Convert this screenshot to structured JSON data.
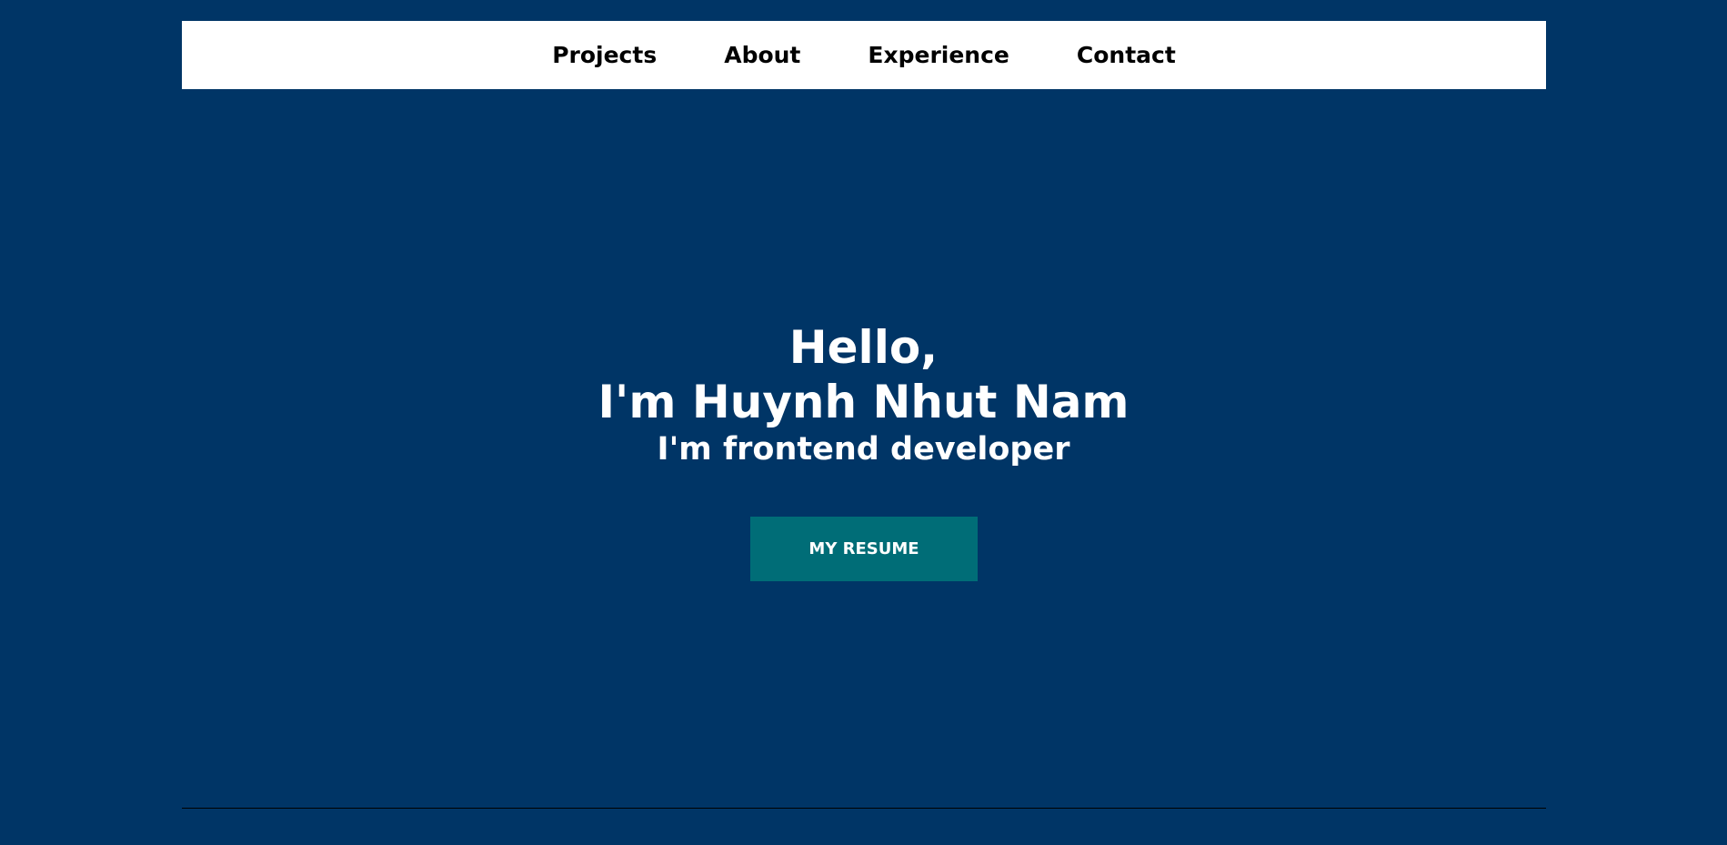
{
  "nav": {
    "items": [
      {
        "label": "Projects"
      },
      {
        "label": "About"
      },
      {
        "label": "Experience"
      },
      {
        "label": "Contact"
      }
    ]
  },
  "hero": {
    "greeting": "Hello,",
    "name": "I'm Huynh Nhut Nam",
    "role": "I'm frontend developer",
    "button_label": "MY RESUME"
  },
  "colors": {
    "background": "#003566",
    "navbar": "#ffffff",
    "button": "#006d77",
    "text_light": "#ffffff",
    "text_dark": "#000000"
  }
}
